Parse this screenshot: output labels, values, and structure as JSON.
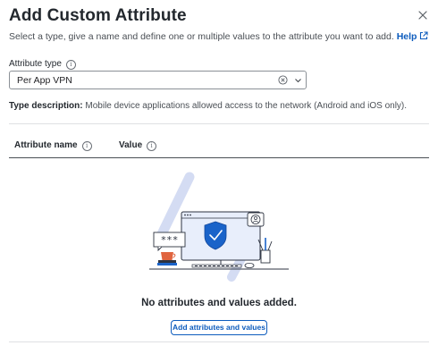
{
  "dialog": {
    "title": "Add Custom Attribute",
    "subtitle": "Select a type, give a name and define one or multiple values to the attribute you want to add.",
    "help_label": "Help",
    "close_icon": "close-icon"
  },
  "attribute_type": {
    "label": "Attribute type",
    "selected": "Per App VPN",
    "icons": [
      "info-icon",
      "clear-icon",
      "chevron-down-icon"
    ]
  },
  "type_description": {
    "label": "Type description:",
    "text": "Mobile device applications allowed access to the network (Android and iOS only)."
  },
  "table": {
    "columns": [
      "Attribute name",
      "Value"
    ]
  },
  "empty_state": {
    "message": "No attributes and values added.",
    "button_label": "Add attributes and values",
    "illustration_text": "***"
  },
  "colors": {
    "accent": "#0d5cbd",
    "shield": "#1a63c9",
    "cup": "#e0643f"
  }
}
